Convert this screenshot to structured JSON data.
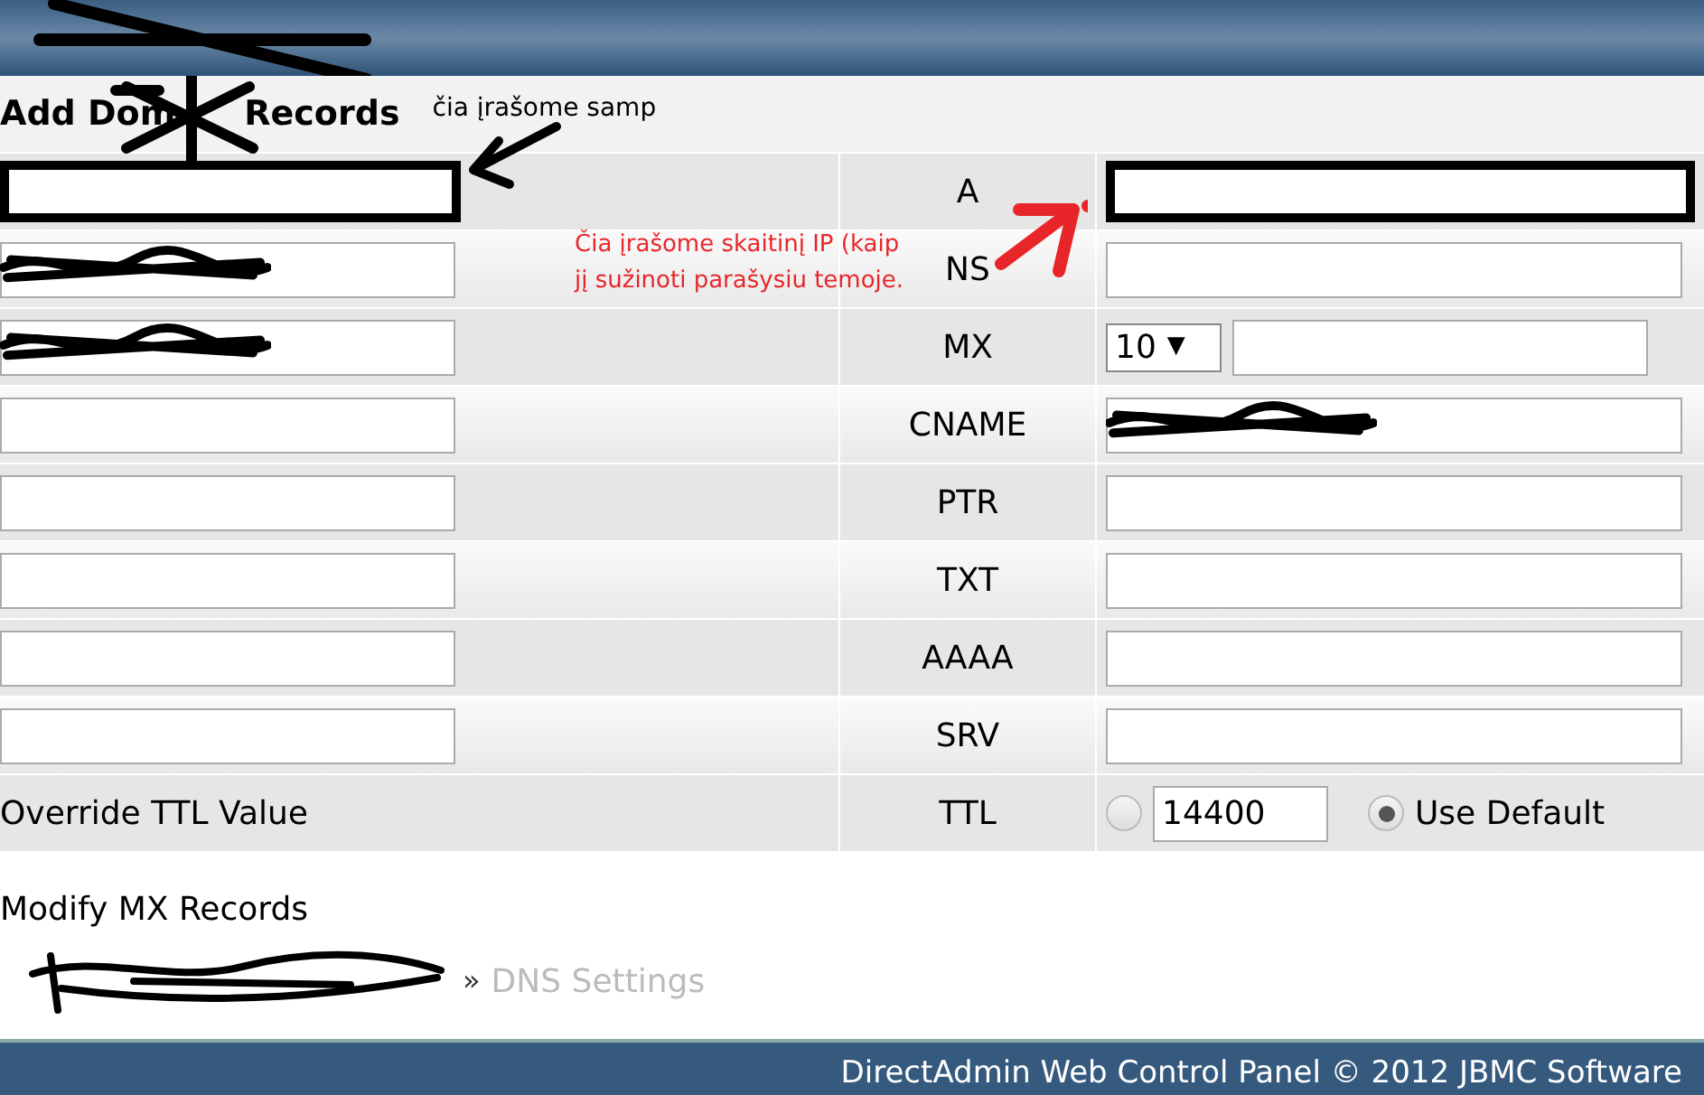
{
  "heading": {
    "parts": [
      "Add Dom",
      "Records"
    ],
    "redacted": true
  },
  "header": {
    "redacted": true
  },
  "rows": [
    {
      "kind": "text",
      "left_outlined": true,
      "left_redacted": false,
      "type": "A",
      "right_outlined": true,
      "right_redacted": false
    },
    {
      "kind": "text",
      "left_outlined": false,
      "left_redacted": true,
      "type": "NS",
      "right_outlined": false,
      "right_redacted": false
    },
    {
      "kind": "mx",
      "left_outlined": false,
      "left_redacted": true,
      "type": "MX",
      "priority": "10",
      "caret": "▼"
    },
    {
      "kind": "text",
      "left_outlined": false,
      "left_redacted": false,
      "type": "CNAME",
      "right_outlined": false,
      "right_redacted": true
    },
    {
      "kind": "text",
      "left_outlined": false,
      "left_redacted": false,
      "type": "PTR",
      "right_outlined": false,
      "right_redacted": false
    },
    {
      "kind": "text",
      "left_outlined": false,
      "left_redacted": false,
      "type": "TXT",
      "right_outlined": false,
      "right_redacted": false
    },
    {
      "kind": "text",
      "left_outlined": false,
      "left_redacted": false,
      "type": "AAAA",
      "right_outlined": false,
      "right_redacted": false
    },
    {
      "kind": "text",
      "left_outlined": false,
      "left_redacted": false,
      "type": "SRV",
      "right_outlined": false,
      "right_redacted": false
    },
    {
      "kind": "ttl",
      "label": "Override TTL Value",
      "type": "TTL",
      "custom_selected": false,
      "value": "14400",
      "default_selected": true,
      "default_label": "Use Default"
    }
  ],
  "annotations": {
    "top_note": "čia įrašome samp",
    "red_note": "Čia įrašome skaitinį IP (kaip jį sužinoti parašysiu temoje."
  },
  "link": "Modify MX Records",
  "breadcrumb": {
    "redacted": true,
    "separator": "»",
    "current": "DNS Settings"
  },
  "footer": "DirectAdmin Web Control Panel © 2012 JBMC Software"
}
